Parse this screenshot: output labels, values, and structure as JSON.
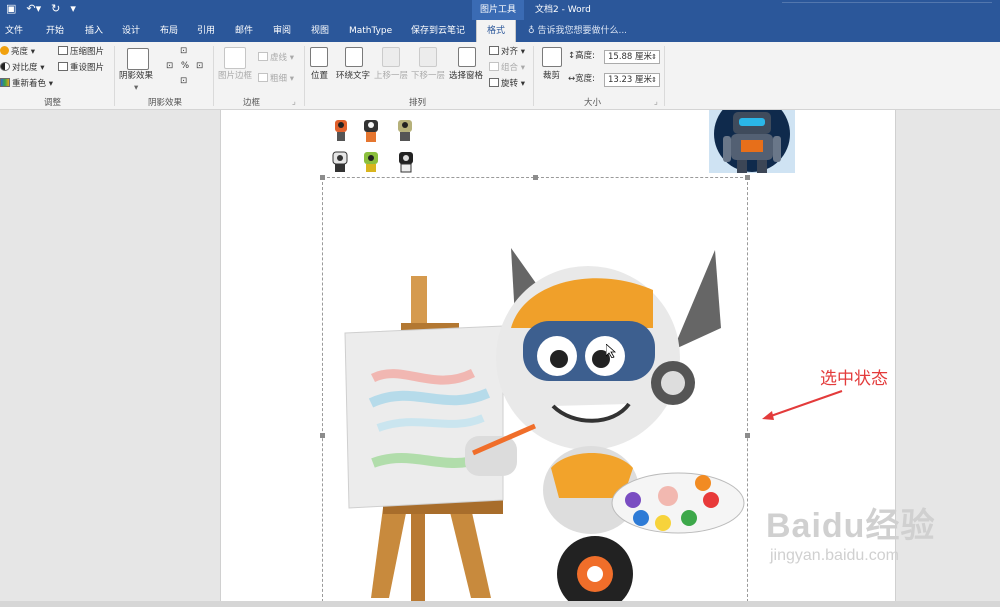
{
  "titlebar": {
    "picture_tools": "图片工具",
    "document_title": "文档2 - Word"
  },
  "tabs": [
    "文件",
    "开始",
    "插入",
    "设计",
    "布局",
    "引用",
    "邮件",
    "审阅",
    "视图",
    "MathType",
    "保存到云笔记",
    "格式"
  ],
  "tell_me": "告诉我您想要做什么...",
  "ribbon": {
    "adjust": {
      "brightness": "亮度",
      "contrast": "对比度",
      "recolor": "重新着色",
      "compress": "压缩图片",
      "reset": "重设图片",
      "group": "调整"
    },
    "shadow": {
      "effects": "阴影效果",
      "group": "阴影效果"
    },
    "border": {
      "picture_border": "图片边框",
      "dashes": "虚线",
      "weight": "粗细",
      "group": "边框"
    },
    "arrange": {
      "position": "位置",
      "wrap_text": "环绕文字",
      "bring_forward": "上移一层",
      "send_backward": "下移一层",
      "selection_pane": "选择窗格",
      "align": "对齐",
      "group_objects": "组合",
      "rotate": "旋转",
      "group": "排列"
    },
    "size": {
      "crop": "裁剪",
      "height_label": "高度:",
      "height_value": "15.88 厘米",
      "width_label": "宽度:",
      "width_value": "13.23 厘米",
      "group": "大小"
    }
  },
  "annotation": "选中状态",
  "watermark": {
    "brand": "Baidu经验",
    "url": "jingyan.baidu.com"
  },
  "colors": {
    "word_blue": "#2b579a",
    "ribbon_bg": "#f3f3f3",
    "annotation_red": "#e33b3b"
  }
}
